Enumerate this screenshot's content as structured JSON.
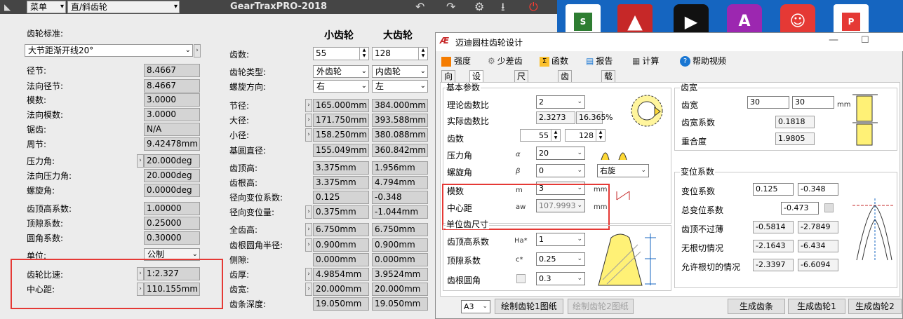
{
  "gt": {
    "menu_label": "菜单",
    "gear_type": "直/斜齿轮",
    "app_title": "GearTraxPRO-2018",
    "standard_label": "齿轮标准:",
    "standard_value": "大节距渐开线20°",
    "left_fields": [
      {
        "label": "径节:",
        "value": "8.4667"
      },
      {
        "label": "法向径节:",
        "value": "8.4667"
      },
      {
        "label": "模数:",
        "value": "3.0000"
      },
      {
        "label": "法向模数:",
        "value": "3.0000"
      },
      {
        "label": "锯齿:",
        "value": "N/A"
      },
      {
        "label": "周节:",
        "value": "9.42478mm"
      }
    ],
    "angle_fields": [
      {
        "label": "压力角:",
        "value": "20.000deg"
      },
      {
        "label": "法向压力角:",
        "value": "20.000deg"
      },
      {
        "label": "螺旋角:",
        "value": "0.0000deg"
      }
    ],
    "coef_fields": [
      {
        "label": "齿顶高系数:",
        "value": "1.00000"
      },
      {
        "label": "顶隙系数:",
        "value": "0.25000"
      },
      {
        "label": "圆角系数:",
        "value": "0.30000"
      }
    ],
    "unit_label": "单位:",
    "unit_value": "公制",
    "ratio_label": "齿轮比速:",
    "ratio_value": "1:2.327",
    "center_label": "中心距:",
    "center_value": "110.155mm",
    "pinion_header": "小齿轮",
    "gear_header": "大齿轮",
    "teeth_label": "齿数:",
    "teeth_pinion": "55",
    "teeth_gear": "128",
    "type_label": "齿轮类型:",
    "type_pinion": "外齿轮",
    "type_gear": "内齿轮",
    "hand_label": "螺旋方向:",
    "hand_pinion": "右",
    "hand_gear": "左",
    "dims": [
      {
        "label": "节径:",
        "p": "165.000mm",
        "g": "384.000mm"
      },
      {
        "label": "大径:",
        "p": "171.750mm",
        "g": "393.588mm"
      },
      {
        "label": "小径:",
        "p": "158.250mm",
        "g": "380.088mm"
      },
      {
        "label": "基圆直径:",
        "p": "155.049mm",
        "g": "360.842mm"
      }
    ],
    "dims2": [
      {
        "label": "齿顶高:",
        "p": "3.375mm",
        "g": "1.956mm"
      },
      {
        "label": "齿根高:",
        "p": "3.375mm",
        "g": "4.794mm"
      },
      {
        "label": "径向变位系数:",
        "p": "0.125",
        "g": "-0.348"
      },
      {
        "label": "径向变位量:",
        "p": "0.375mm",
        "g": "-1.044mm"
      }
    ],
    "dims3": [
      {
        "label": "全齿高:",
        "p": "6.750mm",
        "g": "6.750mm"
      },
      {
        "label": "齿根圆角半径:",
        "p": "0.900mm",
        "g": "0.900mm"
      },
      {
        "label": "侧隙:",
        "p": "0.000mm",
        "g": "0.000mm"
      },
      {
        "label": "齿厚:",
        "p": "4.9854mm",
        "g": "3.9524mm"
      },
      {
        "label": "齿宽:",
        "p": "20.000mm",
        "g": "20.000mm"
      },
      {
        "label": "齿条深度:",
        "p": "19.050mm",
        "g": "19.050mm"
      }
    ]
  },
  "dlg": {
    "title": "迈迪圆柱齿轮设计",
    "toolbar": [
      "强度",
      "少差齿",
      "函数",
      "报告",
      "计算",
      "帮助视频"
    ],
    "tabs": [
      "向导",
      "设计参数",
      "尺寸参数",
      "齿轮精度",
      "载荷"
    ],
    "basic_group": "基本参数",
    "ratio_label": "理论齿数比",
    "ratio_value": "2",
    "actual_label": "实际齿数比",
    "actual_value": "2.3273",
    "actual_pct": "16.365",
    "pct": "%",
    "teeth_label": "齿数",
    "teeth1": "55",
    "teeth2": "128",
    "pa_label": "压力角",
    "pa_sym": "α",
    "pa_value": "20",
    "helix_label": "螺旋角",
    "helix_sym": "β",
    "helix_value": "0",
    "helix_dir": "右旋",
    "module_label": "模数",
    "module_sym": "m",
    "module_value": "3",
    "mm": "mm",
    "center_label": "中心距",
    "center_sym": "aw",
    "center_value": "107.9993",
    "unit_group": "单位齿尺寸",
    "ha_label": "齿顶高系数",
    "ha_sym": "Ha*",
    "ha_value": "1",
    "c_label": "顶隙系数",
    "c_sym": "c*",
    "c_value": "0.25",
    "root_label": "齿根圆角",
    "root_value": "0.3",
    "width_group": "齿宽",
    "width_label": "齿宽",
    "width1": "30",
    "width2": "30",
    "wcoef_label": "齿宽系数",
    "wcoef_value": "0.1818",
    "overlap_label": "重合度",
    "overlap_value": "1.9805",
    "shift_group": "变位系数",
    "shift_label": "变位系数",
    "shift1": "0.125",
    "shift2": "-0.348",
    "total_label": "总变位系数",
    "total_value": "-0.473",
    "thin_label": "齿顶不过薄",
    "thin1": "-0.5814",
    "thin2": "-2.7849",
    "undercut_label": "无根切情况",
    "uc1": "-2.1643",
    "uc2": "-6.434",
    "allow_label": "允许根切的情况",
    "al1": "-2.3397",
    "al2": "-6.6094",
    "paper": "A3",
    "draw1": "绘制齿轮1图纸",
    "draw2": "绘制齿轮2图纸",
    "gen_rack": "生成齿条",
    "gen1": "生成齿轮1",
    "gen2": "生成齿轮2"
  },
  "colors": {
    "red": "#e53935",
    "dark": "#454545"
  }
}
